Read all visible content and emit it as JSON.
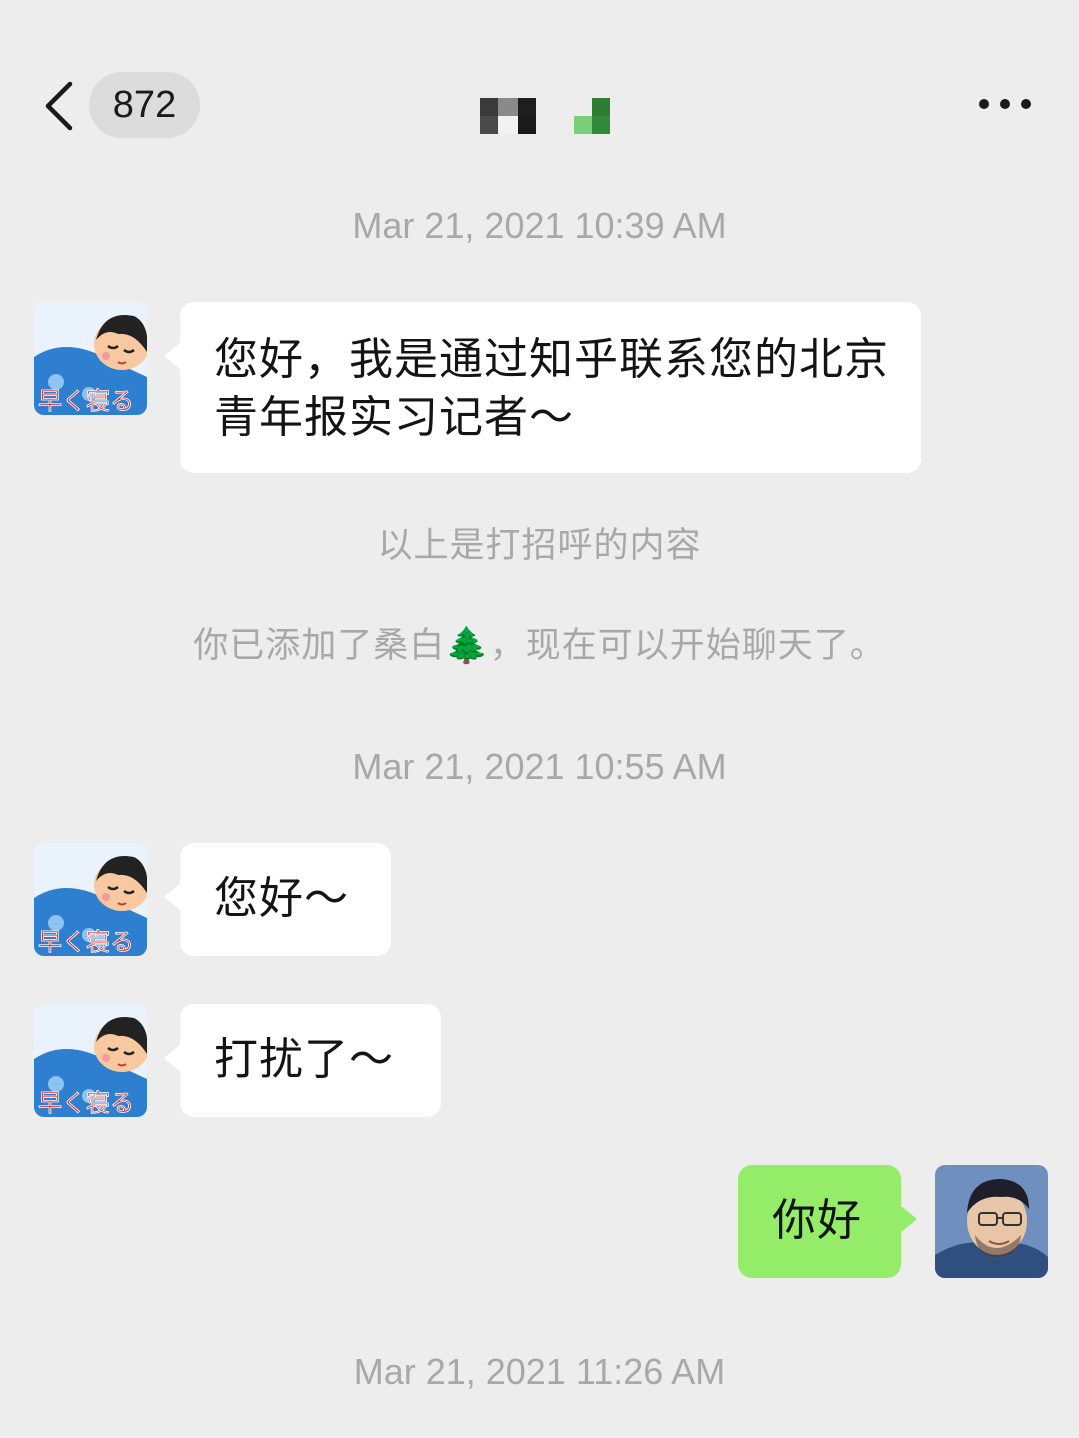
{
  "header": {
    "unread_count": "872",
    "back_icon": "chevron-left-icon",
    "more_icon": "more-dots-icon"
  },
  "messages": [
    {
      "type": "time",
      "text": "Mar 21, 2021 10:39 AM"
    },
    {
      "type": "incoming",
      "text": "您好，我是通过知乎联系您的北京青年报实习记者～"
    },
    {
      "type": "system",
      "text": "以上是打招呼的内容"
    },
    {
      "type": "system",
      "text": "你已添加了桑白🌲，现在可以开始聊天了。"
    },
    {
      "type": "time",
      "text": "Mar 21, 2021 10:55 AM"
    },
    {
      "type": "incoming",
      "text": "您好～"
    },
    {
      "type": "incoming",
      "text": "打扰了～"
    },
    {
      "type": "outgoing",
      "text": "你好"
    },
    {
      "type": "time",
      "text": "Mar 21, 2021 11:26 AM"
    }
  ],
  "contact_avatar": {
    "caption": "早く寝る"
  },
  "colors": {
    "background": "#ededed",
    "incoming_bubble": "#ffffff",
    "outgoing_bubble": "#95ec69",
    "meta_text": "#a8a8a8"
  }
}
